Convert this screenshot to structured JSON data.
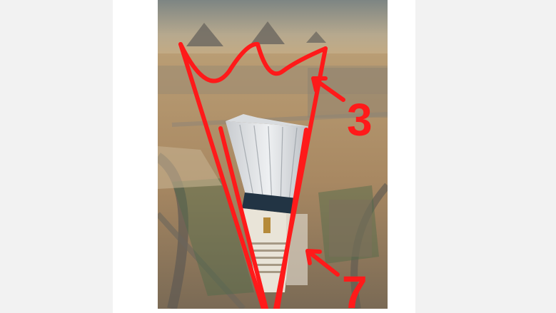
{
  "image": {
    "description_icon": "aerial-photo-icon"
  },
  "annotations": {
    "label_top": "3",
    "label_bottom": "7",
    "color": "#ff1a1a"
  },
  "colors": {
    "background": "#f2f2f2",
    "page": "#ffffff",
    "sand": "#c9a878",
    "sky": "#8a8f8e"
  }
}
